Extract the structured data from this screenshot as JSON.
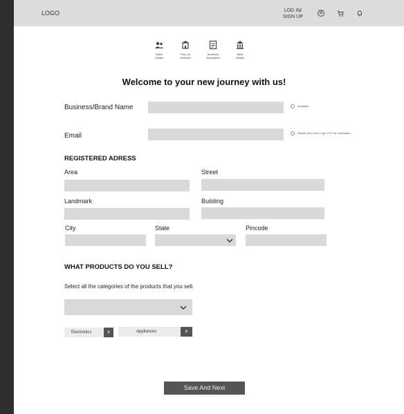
{
  "topbar": {
    "logo": "LOGO",
    "login_line1": "LOG IN/",
    "login_line2": "SIGN UP",
    "icons": [
      "user-icon",
      "cart-icon",
      "bell-icon"
    ]
  },
  "steps": [
    {
      "label_line1": "Basic",
      "label_line2": "Details",
      "icon": "users-icon"
    },
    {
      "label_line1": "Pick-Up",
      "label_line2": "Address",
      "icon": "building-icon"
    },
    {
      "label_line1": "Business",
      "label_line2": "Information",
      "icon": "document-icon"
    },
    {
      "label_line1": "Bank",
      "label_line2": "Details",
      "icon": "bank-icon"
    }
  ],
  "welcome": "Welcome to your new journey with us!",
  "business": {
    "label": "Business/Brand Name",
    "hint": "Available"
  },
  "email": {
    "label": "Email",
    "hint": "Please click here to get OTP for verification."
  },
  "address": {
    "heading": "REGISTERED ADRESS",
    "area": "Area",
    "street": "Street",
    "landmark": "Landmark",
    "building": "Building",
    "city": "City",
    "state": "State",
    "pincode": "Pincode"
  },
  "products": {
    "heading": "WHAT PRODUCTS DO YOU SELL?",
    "subtext": "Select all the categories of the products that you sell.",
    "chips": [
      "Electronics",
      "Appliances"
    ],
    "remove_glyph": "×"
  },
  "save_label": "Save And Next",
  "colors": {
    "topbar": "#dcdcdc",
    "field": "#d9d9d9",
    "button": "#555555",
    "sidebar": "#2e2e2e"
  }
}
